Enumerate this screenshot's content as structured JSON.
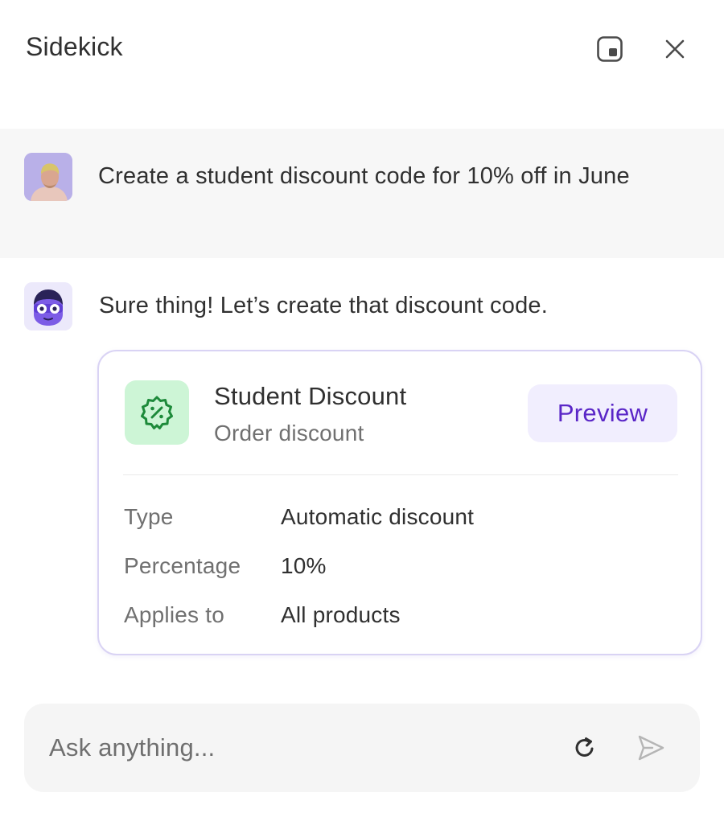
{
  "header": {
    "title": "Sidekick",
    "dock_icon": "dock-panel-icon",
    "close_icon": "close-icon"
  },
  "conversation": {
    "user_message": {
      "text": "Create a student discount code for 10% off in June",
      "avatar": "user-avatar"
    },
    "assistant_message": {
      "text": "Sure thing! Let’s create that discount code.",
      "avatar": "sidekick-avatar"
    }
  },
  "discount_card": {
    "icon": "discount-badge-icon",
    "title": "Student Discount",
    "subtitle": "Order discount",
    "preview_label": "Preview",
    "rows": [
      {
        "label": "Type",
        "value": "Automatic discount"
      },
      {
        "label": "Percentage",
        "value": "10%"
      },
      {
        "label": "Applies to",
        "value": "All products"
      }
    ]
  },
  "composer": {
    "placeholder": "Ask anything...",
    "value": "",
    "refresh_icon": "refresh-icon",
    "send_icon": "send-icon"
  },
  "colors": {
    "accent": "#5a26c7",
    "preview_bg": "#f1eefe",
    "card_border": "#d9d3f4",
    "discount_icon_bg": "#cdf5d6",
    "discount_icon": "#1d8a3a"
  }
}
